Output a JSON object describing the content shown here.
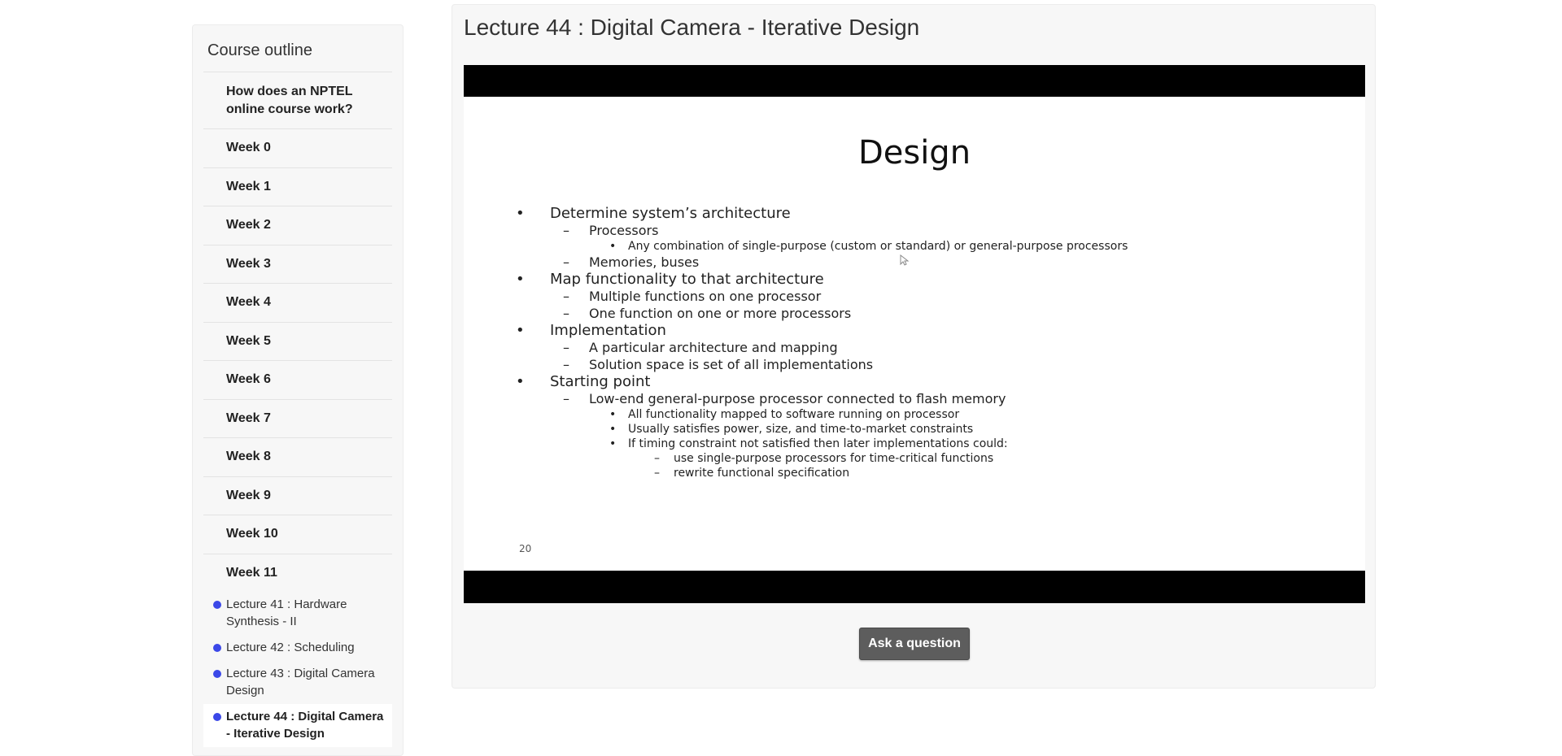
{
  "sidebar": {
    "title": "Course outline",
    "items": [
      {
        "label": "How does an NPTEL online course work?"
      },
      {
        "label": "Week 0"
      },
      {
        "label": "Week 1"
      },
      {
        "label": "Week 2"
      },
      {
        "label": "Week 3"
      },
      {
        "label": "Week 4"
      },
      {
        "label": "Week 5"
      },
      {
        "label": "Week 6"
      },
      {
        "label": "Week 7"
      },
      {
        "label": "Week 8"
      },
      {
        "label": "Week 9"
      },
      {
        "label": "Week 10"
      },
      {
        "label": "Week 11"
      }
    ],
    "lectures": [
      {
        "label": "Lecture 41 : Hardware Synthesis - II"
      },
      {
        "label": "Lecture 42 : Scheduling"
      },
      {
        "label": "Lecture 43 : Digital Camera Design"
      },
      {
        "label": "Lecture 44 : Digital Camera - Iterative Design"
      }
    ],
    "accent_color": "#3b48e8"
  },
  "main": {
    "title": "Lecture 44 : Digital Camera - Iterative Design",
    "ask_button": "Ask a question"
  },
  "slide": {
    "heading": "Design",
    "lines": [
      "Determine system’s architecture",
      "Processors",
      "Any combination of single-purpose (custom or standard) or general-purpose processors",
      "Memories, buses",
      "Map functionality to that architecture",
      "Multiple functions on one processor",
      "One function on one or more processors",
      "Implementation",
      "A particular architecture and mapping",
      "Solution space is set of all implementations",
      "Starting point",
      "Low-end general-purpose processor connected to flash memory",
      "All functionality mapped to software running on processor",
      "Usually satisfies power, size, and time-to-market constraints",
      "If timing constraint not satisfied then later implementations could:",
      "use single-purpose processors for time-critical functions",
      "rewrite functional specification"
    ],
    "page_number": "20"
  }
}
